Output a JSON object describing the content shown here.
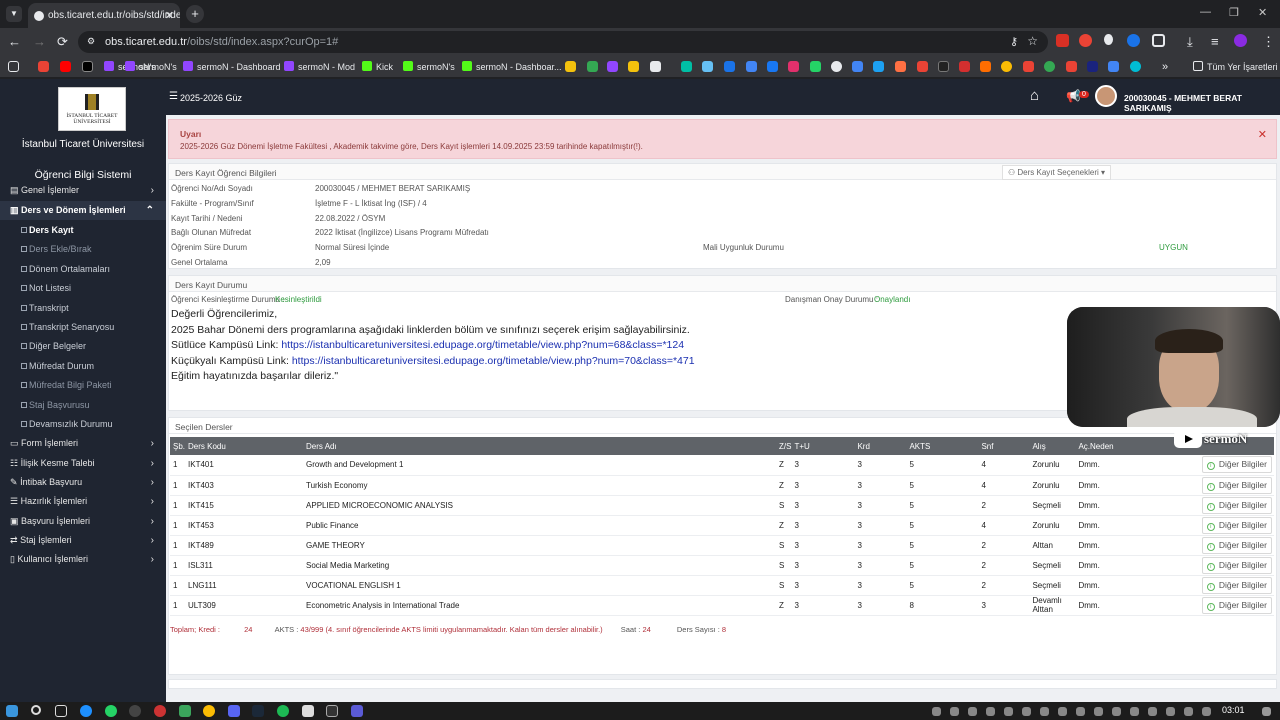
{
  "browser": {
    "tab_title": "obs.ticaret.edu.tr/oibs/std/index.",
    "url_host": "obs.ticaret.edu.tr",
    "url_path": "/oibs/std/index.aspx?curOp=1#",
    "bookmarks": [
      "sermoN's",
      "sermoN - Dashboard",
      "sermoN - Mod",
      "Kick",
      "sermoN's",
      "sermoN - Dashboar...",
      "Tüm Yer İşaretleri"
    ]
  },
  "sidebar": {
    "university": "İstanbul Ticaret Üniversitesi",
    "logo_line1": "İSTANBUL TİCARET",
    "logo_line2": "ÜNİVERSİTESİ",
    "system_title": "Öğrenci Bilgi Sistemi",
    "menu": [
      {
        "label": "Genel İşlemler"
      },
      {
        "label": "Ders ve Dönem İşlemleri"
      },
      {
        "label": "Form İşlemleri"
      },
      {
        "label": "İlişik Kesme Talebi"
      },
      {
        "label": "İntibak Başvuru"
      },
      {
        "label": "Hazırlık İşlemleri"
      },
      {
        "label": "Başvuru İşlemleri"
      },
      {
        "label": "Staj İşlemleri"
      },
      {
        "label": "Kullanıcı İşlemleri"
      }
    ],
    "submenu": [
      {
        "label": "Ders Kayıt"
      },
      {
        "label": "Ders Ekle/Bırak"
      },
      {
        "label": "Dönem Ortalamaları"
      },
      {
        "label": "Not Listesi"
      },
      {
        "label": "Transkript"
      },
      {
        "label": "Transkript Senaryosu"
      },
      {
        "label": "Diğer Belgeler"
      },
      {
        "label": "Müfredat Durum"
      },
      {
        "label": "Müfredat Bilgi Paketi"
      },
      {
        "label": "Staj Başvurusu"
      },
      {
        "label": "Devamsızlık Durumu"
      }
    ]
  },
  "header": {
    "term": "2025-2026 Güz",
    "notif_count": "0",
    "user": "200030045 - MEHMET BERAT SARIKAMIŞ"
  },
  "alert": {
    "title": "Uyarı",
    "text": "2025-2026 Güz Dönemi İşletme Fakültesi , Akademik takvime göre, Ders Kayıt işlemleri 14.09.2025 23:59 tarihinde kapatılmıştır(!)."
  },
  "student_panel": {
    "title": "Ders Kayıt Öğrenci Bilgileri",
    "options_button": "Ders Kayıt Seçenekleri",
    "rows": [
      {
        "label": "Öğrenci No/Adı Soyadı",
        "value": "200030045 / MEHMET BERAT SARIKAMIŞ"
      },
      {
        "label": "Fakülte - Program/Sınıf",
        "value": "İşletme F - L İktisat İng (ISF) / 4"
      },
      {
        "label": "Kayıt Tarihi / Nedeni",
        "value": "22.08.2022 / ÖSYM"
      },
      {
        "label": "Bağlı Olunan Müfredat",
        "value": "2022 İktisat (İngilizce) Lisans Programı Müfredatı"
      },
      {
        "label": "Öğrenim Süre Durum",
        "value": "Normal Süresi İçinde"
      },
      {
        "label": "Genel Ortalama",
        "value": "2,09"
      }
    ],
    "mail_label": "Mali Uygunluk Durumu",
    "mail_value": "UYGUN"
  },
  "status_panel": {
    "title": "Ders Kayıt Durumu",
    "confirm_label": "Öğrenci Kesinleştirme Durumu :",
    "confirm_value": "Kesinleştirildi",
    "advisor_label": "Danışman Onay Durumu :",
    "advisor_value": "Onaylandı",
    "msg1": "Değerli Öğrencilerimiz,",
    "msg2": "2025 Bahar Dönemi ders programlarına aşağıdaki linklerden bölüm ve sınıfınızı seçerek erişim sağlayabilirsiniz.",
    "msg3_label": "Sütlüce Kampüsü Link:",
    "msg3_link": "https://istanbulticaretuniversitesi.edupage.org/timetable/view.php?num=68&class=*124",
    "msg4_label": "Küçükyalı Kampüsü Link:",
    "msg4_link": "https://istanbulticaretuniversitesi.edupage.org/timetable/view.php?num=70&class=*471",
    "msg5": "Eğitim hayatınızda başarılar dileriz.\""
  },
  "courses_panel": {
    "title": "Seçilen Dersler",
    "headers": [
      "Şb.",
      "Ders Kodu",
      "Ders Adı",
      "Z/S",
      "T+U",
      "Krd",
      "AKTS",
      "Snf",
      "Alış",
      "Aç.Neden"
    ],
    "details_label": "Diğer Bilgiler",
    "rows": [
      {
        "sb": "1",
        "code": "IKT401",
        "name": "Growth and Development 1",
        "zs": "Z",
        "tu": "3",
        "krd": "3",
        "akts": "5",
        "snf": "4",
        "alis": "Zorunlu",
        "neden": "Dmm."
      },
      {
        "sb": "1",
        "code": "IKT403",
        "name": "Turkish Economy",
        "zs": "Z",
        "tu": "3",
        "krd": "3",
        "akts": "5",
        "snf": "4",
        "alis": "Zorunlu",
        "neden": "Dmm."
      },
      {
        "sb": "1",
        "code": "IKT415",
        "name": "APPLIED MICROECONOMIC ANALYSIS",
        "zs": "S",
        "tu": "3",
        "krd": "3",
        "akts": "5",
        "snf": "2",
        "alis": "Seçmeli",
        "neden": "Dmm."
      },
      {
        "sb": "1",
        "code": "IKT453",
        "name": "Public Finance",
        "zs": "Z",
        "tu": "3",
        "krd": "3",
        "akts": "5",
        "snf": "4",
        "alis": "Zorunlu",
        "neden": "Dmm."
      },
      {
        "sb": "1",
        "code": "IKT489",
        "name": "GAME THEORY",
        "zs": "S",
        "tu": "3",
        "krd": "3",
        "akts": "5",
        "snf": "2",
        "alis": "Alttan",
        "neden": "Dmm."
      },
      {
        "sb": "1",
        "code": "ISL311",
        "name": "Social Media Marketing",
        "zs": "S",
        "tu": "3",
        "krd": "3",
        "akts": "5",
        "snf": "2",
        "alis": "Seçmeli",
        "neden": "Dmm."
      },
      {
        "sb": "1",
        "code": "LNG111",
        "name": "VOCATIONAL ENGLISH 1",
        "zs": "S",
        "tu": "3",
        "krd": "3",
        "akts": "5",
        "snf": "2",
        "alis": "Seçmeli",
        "neden": "Dmm."
      },
      {
        "sb": "1",
        "code": "ULT309",
        "name": "Econometric Analysis in International Trade",
        "zs": "Z",
        "tu": "3",
        "krd": "3",
        "akts": "8",
        "snf": "3",
        "alis": "Devamlı Alttan",
        "neden": "Dmm."
      }
    ],
    "footer": {
      "kredi_label": "Toplam; Kredi :",
      "kredi_value": "24",
      "akts_label": "AKTS :",
      "akts_value": "43/999 (4. sınıf öğrencilerinde AKTS limiti uygulanmamaktadır. Kalan tüm dersler alınabilir.)",
      "saat_label": "Saat :",
      "saat_value": "24",
      "sayi_label": "Ders Sayısı :",
      "sayi_value": "8"
    }
  },
  "overlay": {
    "channel": "sermoN"
  },
  "taskbar": {
    "time": "03:01"
  }
}
